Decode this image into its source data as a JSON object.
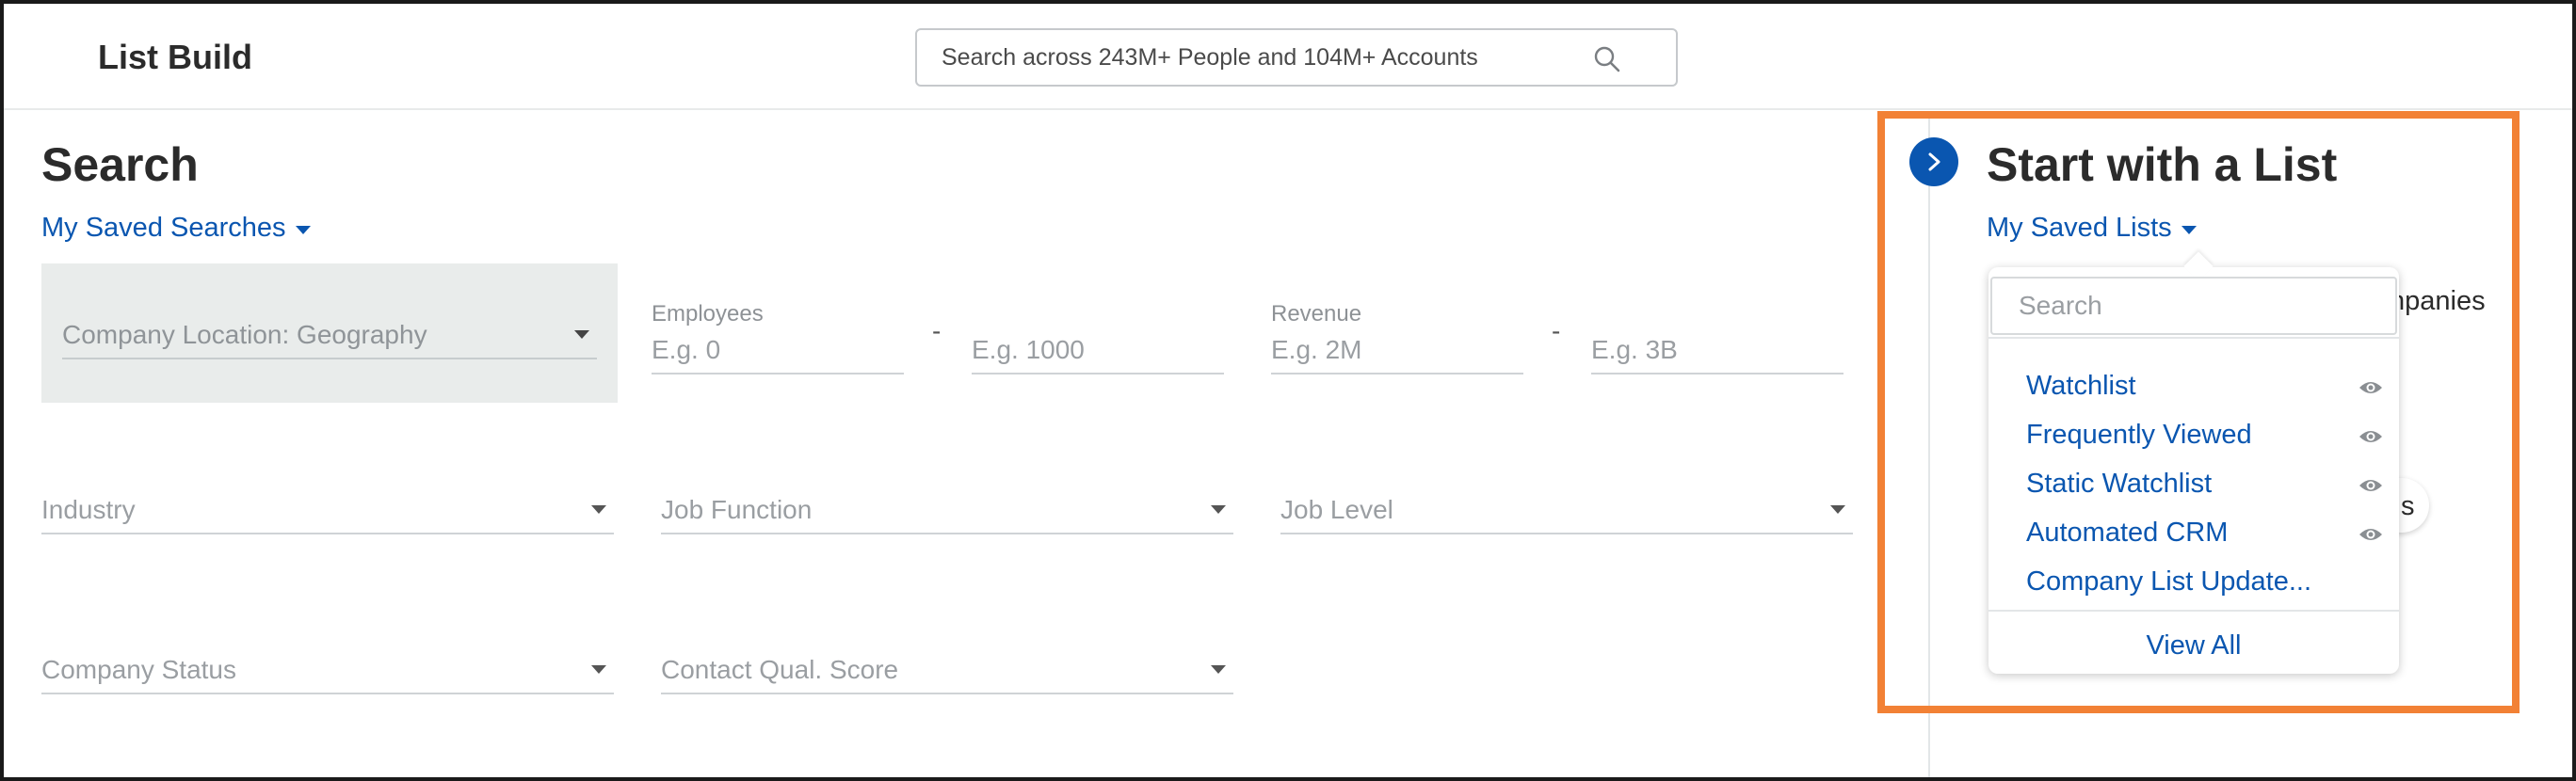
{
  "header": {
    "app_title": "List Build",
    "search_placeholder": "Search across 243M+ People and 104M+ Accounts"
  },
  "search_panel": {
    "title": "Search",
    "saved_searches_label": "My Saved Searches",
    "filters": {
      "company_location": "Company Location: Geography",
      "employees_label": "Employees",
      "employees_min_placeholder": "E.g. 0",
      "employees_max_placeholder": "E.g. 1000",
      "revenue_label": "Revenue",
      "revenue_min_placeholder": "E.g. 2M",
      "revenue_max_placeholder": "E.g. 3B",
      "range_separator": "-",
      "industry": "Industry",
      "job_function": "Job Function",
      "job_level": "Job Level",
      "company_status": "Company Status",
      "contact_qual_score": "Contact Qual. Score"
    }
  },
  "list_panel": {
    "title": "Start with a List",
    "saved_lists_label": "My Saved Lists",
    "partial_text_companies": "npanies",
    "partial_text_s": "s",
    "dropdown": {
      "search_placeholder": "Search",
      "items": [
        {
          "label": "Watchlist",
          "icon": "eye-icon"
        },
        {
          "label": "Frequently Viewed",
          "icon": "eye-icon"
        },
        {
          "label": "Static Watchlist",
          "icon": "eye-icon"
        },
        {
          "label": "Automated CRM",
          "icon": "eye-icon"
        },
        {
          "label": "Company List Update..."
        }
      ],
      "view_all_label": "View All"
    }
  },
  "colors": {
    "link_blue": "#0a56b0",
    "highlight_orange": "#f28135",
    "placeholder_gray": "#9a9ea2"
  }
}
